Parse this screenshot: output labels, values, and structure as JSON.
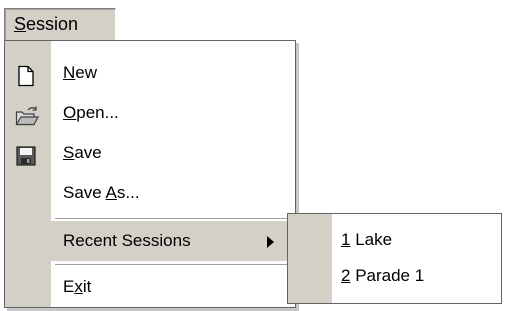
{
  "menubar": {
    "title_hotkey": "S",
    "title_rest": "ession"
  },
  "menu": {
    "items": [
      {
        "hotkey": "N",
        "rest": "ew",
        "icon": "new-file-icon"
      },
      {
        "hotkey": "O",
        "rest": "pen...",
        "icon": "open-folder-icon"
      },
      {
        "hotkey": "S",
        "rest": "ave",
        "icon": "save-disk-icon"
      },
      {
        "pre": "Save ",
        "hotkey": "A",
        "rest": "s..."
      },
      {
        "label": "Recent Sessions",
        "has_submenu": true
      },
      {
        "pre": "E",
        "hotkey": "x",
        "rest": "it"
      }
    ]
  },
  "submenu": {
    "items": [
      {
        "hotkey": "1",
        "rest": " Lake"
      },
      {
        "hotkey": "2",
        "rest": " Parade 1"
      }
    ]
  },
  "colors": {
    "menu_gutter": "#d4d0c8",
    "menu_bg": "#ffffff",
    "border": "#646464"
  }
}
